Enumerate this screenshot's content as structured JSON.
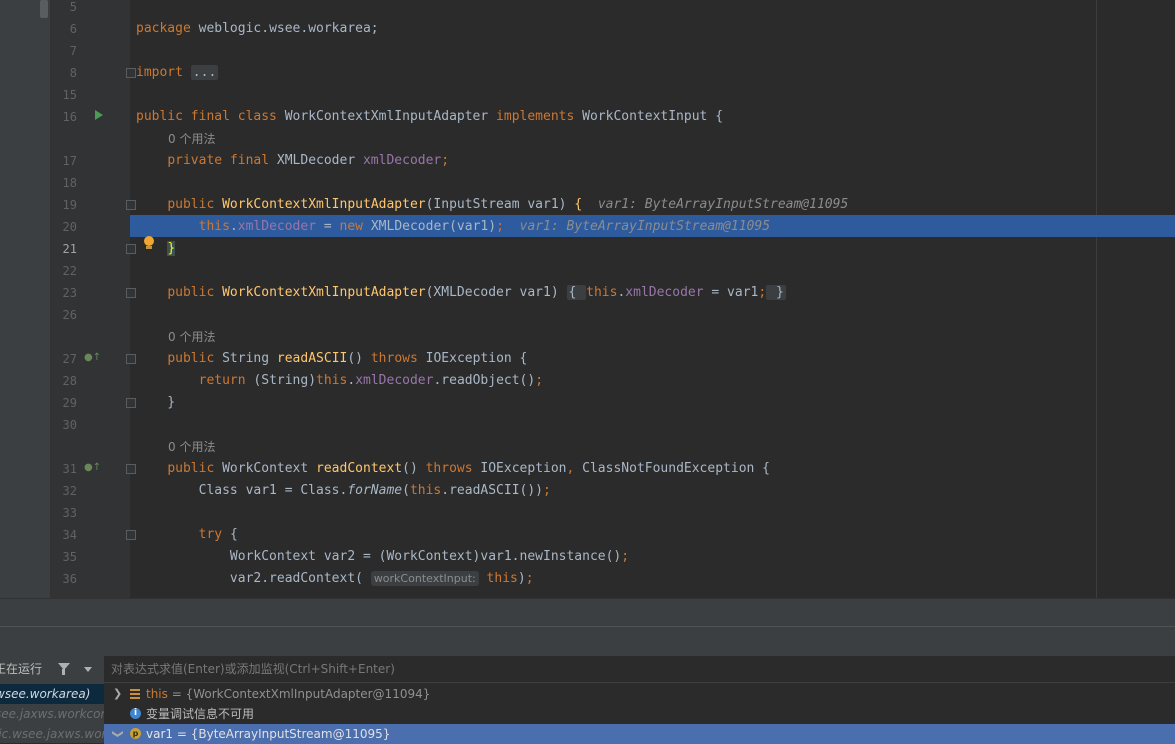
{
  "editor": {
    "lines": [
      {
        "n": "5"
      },
      {
        "n": "6",
        "code": "package weblogic.wsee.workarea;"
      },
      {
        "n": "7"
      },
      {
        "n": "8",
        "code_kw": "import",
        "code_fold": "..."
      },
      {
        "n": "15"
      },
      {
        "n": "16"
      },
      {
        "n": "17"
      },
      {
        "n": "18"
      },
      {
        "n": "19"
      },
      {
        "n": "20"
      },
      {
        "n": "21"
      },
      {
        "n": "22"
      },
      {
        "n": "23"
      },
      {
        "n": "26"
      },
      {
        "n": "27"
      },
      {
        "n": "28"
      },
      {
        "n": "29"
      },
      {
        "n": "30"
      },
      {
        "n": "31"
      },
      {
        "n": "32"
      },
      {
        "n": "33"
      },
      {
        "n": "34"
      },
      {
        "n": "35"
      },
      {
        "n": "36"
      }
    ],
    "usage_hint": "0 个用法",
    "inline_values": {
      "line19": "var1: ByteArrayInputStream@11095",
      "line20": "var1: ByteArrayInputStream@11095"
    },
    "param_hint": "workContextInput:"
  },
  "debugger": {
    "frames_header": "正在运行",
    "frames": [
      {
        "label": "wsee.workarea)",
        "selected": true
      },
      {
        "label": "see.jaxws.workcontext",
        "selected": false
      },
      {
        "label": "lic.wsee.jaxws.work",
        "selected": false
      }
    ],
    "eval_placeholder": "对表达式求值(Enter)或添加监视(Ctrl+Shift+Enter)",
    "variables": [
      {
        "name": "this",
        "value": "= {WorkContextXmlInputAdapter@11094}",
        "expanded": false,
        "icon": "field-icon"
      },
      {
        "info": "变量调试信息不可用",
        "icon": "info-icon"
      },
      {
        "name": "var1",
        "value": "= {ByteArrayInputStream@11095}",
        "expanded": true,
        "icon": "parameter-icon",
        "selected": true
      }
    ]
  },
  "colors": {
    "keyword": "#cc7832",
    "method": "#ffc66d",
    "field": "#9876aa",
    "execution_line": "#2d5b9e"
  }
}
